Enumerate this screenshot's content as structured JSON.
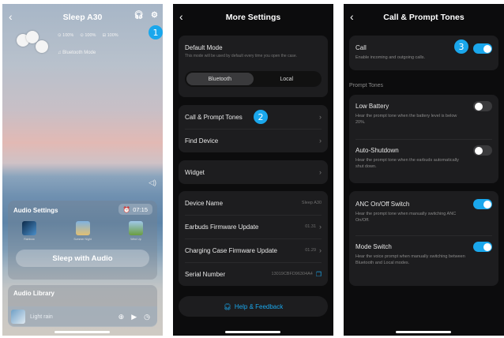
{
  "screen1": {
    "title": "Sleep A30",
    "battery_left": "100%",
    "battery_right": "100%",
    "battery_case": "100%",
    "connection_mode": "Bluetooth Mode",
    "badge": "1",
    "audio_settings_title": "Audio Settings",
    "timer": "07:15",
    "sounds": [
      "Rainbow",
      "Summer Night",
      "Wind Up"
    ],
    "sleep_button": "Sleep with Audio",
    "library_title": "Audio Library",
    "now_playing": "Light rain"
  },
  "screen2": {
    "title": "More Settings",
    "default_mode_title": "Default Mode",
    "default_mode_desc": "This mode will be used by default every time you open the case.",
    "mode_options": [
      "Bluetooth",
      "Local"
    ],
    "selected_mode": "Bluetooth",
    "call_prompt_label": "Call & Prompt Tones",
    "badge": "2",
    "find_device_label": "Find Device",
    "widget_label": "Widget",
    "device_name_label": "Device Name",
    "device_name_value": "Sleep A30",
    "earbuds_fw_label": "Earbuds Firmware Update",
    "earbuds_fw_value": "01.31",
    "case_fw_label": "Charging Case Firmware Update",
    "case_fw_value": "01.29",
    "serial_label": "Serial Number",
    "serial_value": "13019CBFD96304A4",
    "help_label": "Help & Feedback"
  },
  "screen3": {
    "title": "Call & Prompt Tones",
    "call_title": "Call",
    "call_desc": "Enable incoming and outgoing calls.",
    "call_enabled": true,
    "badge": "3",
    "prompt_tones_header": "Prompt Tones",
    "low_battery_title": "Low Battery",
    "low_battery_desc": "Hear the prompt tone when the battery level is below 20%.",
    "low_battery_enabled": false,
    "auto_shutdown_title": "Auto-Shutdown",
    "auto_shutdown_desc": "Hear the prompt tone when the earbuds automatically shut down.",
    "auto_shutdown_enabled": false,
    "anc_title": "ANC On/Off Switch",
    "anc_desc": "Hear the prompt tone when manually switching ANC On/Off.",
    "anc_enabled": true,
    "mode_switch_title": "Mode Switch",
    "mode_switch_desc": "Hear the voice prompt when manually switching between Bluetooth and Local modes.",
    "mode_switch_enabled": true
  },
  "colors": {
    "accent": "#1aa7ec",
    "dark_bg": "#0c0c0d",
    "card_bg": "#1d1d1f"
  }
}
